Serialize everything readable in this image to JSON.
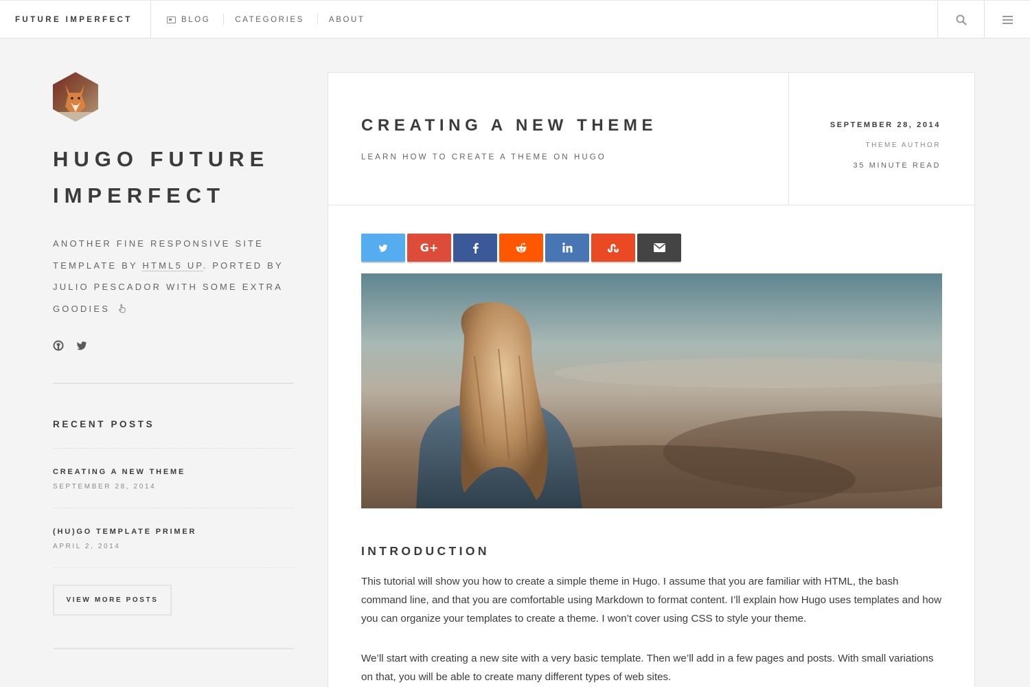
{
  "header": {
    "brand": "FUTURE IMPERFECT",
    "nav": [
      {
        "label": "BLOG",
        "icon": "newspaper-icon"
      },
      {
        "label": "CATEGORIES"
      },
      {
        "label": "ABOUT"
      }
    ],
    "search_icon": "search-icon",
    "menu_icon": "hamburger-menu-icon"
  },
  "sidebar": {
    "title_line1": "HUGO FUTURE",
    "title_line2": "IMPERFECT",
    "desc_part1": "ANOTHER FINE RESPONSIVE SITE TEMPLATE BY ",
    "desc_link": "HTML5 UP",
    "desc_part2": ". PORTED BY JULIO PESCADOR WITH SOME EXTRA GOODIES",
    "social": [
      "github-icon",
      "twitter-icon"
    ],
    "recent_heading": "RECENT POSTS",
    "recent_posts": [
      {
        "title": "CREATING A NEW THEME",
        "date": "SEPTEMBER 28, 2014"
      },
      {
        "title": "(HU)GO TEMPLATE PRIMER",
        "date": "APRIL 2, 2014"
      }
    ],
    "more_button": "VIEW MORE POSTS"
  },
  "post": {
    "title": "CREATING A NEW THEME",
    "subtitle": "LEARN HOW TO CREATE A THEME ON HUGO",
    "date": "SEPTEMBER 28, 2014",
    "author": "THEME AUTHOR",
    "read_time": "35 MINUTE READ",
    "share_buttons": [
      {
        "name": "twitter",
        "color": "#55acee"
      },
      {
        "name": "google-plus",
        "color": "#dd4b39"
      },
      {
        "name": "facebook",
        "color": "#3b5998"
      },
      {
        "name": "reddit",
        "color": "#ff5700"
      },
      {
        "name": "linkedin",
        "color": "#4875b4"
      },
      {
        "name": "stumbleupon",
        "color": "#eb4924"
      },
      {
        "name": "email",
        "color": "#444444"
      }
    ],
    "section_heading": "INTRODUCTION",
    "paragraphs": [
      "This tutorial will show you how to create a simple theme in Hugo. I assume that you are familiar with HTML, the bash command line, and that you are comfortable using Markdown to format content. I’ll explain how Hugo uses templates and how you can organize your templates to create a theme. I won’t cover using CSS to style your theme.",
      "We’ll start with creating a new site with a very basic template. Then we’ll add in a few pages and posts. With small variations on that, you will be able to create many different types of web sites."
    ]
  }
}
